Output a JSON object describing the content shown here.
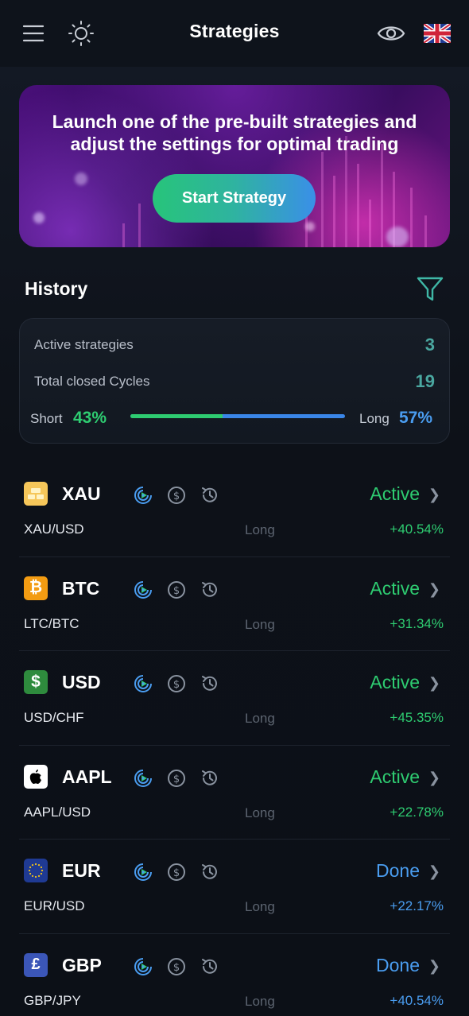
{
  "header": {
    "title": "Strategies",
    "menu_icon": "menu-icon",
    "theme_icon": "sun-icon",
    "visibility_icon": "eye-icon",
    "language_icon": "uk-flag-icon"
  },
  "banner": {
    "headline": "Launch one of the pre-built strategies and adjust the settings for optimal trading",
    "cta_label": "Start Strategy"
  },
  "history": {
    "title": "History",
    "filter_icon": "filter-icon",
    "stats": {
      "active_label": "Active strategies",
      "active_value": "3",
      "closed_label": "Total closed Cycles",
      "closed_value": "19",
      "short_label": "Short",
      "short_value": "43%",
      "long_label": "Long",
      "long_value": "57%",
      "short_fraction": 0.43
    }
  },
  "colors": {
    "active": "#2ecc71",
    "done": "#4a9df0",
    "accent_teal": "#4aa7a0"
  },
  "strategies": [
    {
      "symbol": "XAU",
      "icon": "gold-bars-icon",
      "pair": "XAU/USD",
      "direction": "Long",
      "status": "Active",
      "pnl": "+40.54%"
    },
    {
      "symbol": "BTC",
      "icon": "bitcoin-icon",
      "pair": "LTC/BTC",
      "direction": "Long",
      "status": "Active",
      "pnl": "+31.34%"
    },
    {
      "symbol": "USD",
      "icon": "dollar-icon",
      "pair": "USD/CHF",
      "direction": "Long",
      "status": "Active",
      "pnl": "+45.35%"
    },
    {
      "symbol": "AAPL",
      "icon": "apple-icon",
      "pair": "AAPL/USD",
      "direction": "Long",
      "status": "Active",
      "pnl": "+22.78%"
    },
    {
      "symbol": "EUR",
      "icon": "eu-flag-icon",
      "pair": "EUR/USD",
      "direction": "Long",
      "status": "Done",
      "pnl": "+22.17%"
    },
    {
      "symbol": "GBP",
      "icon": "pound-icon",
      "pair": "GBP/JPY",
      "direction": "Long",
      "status": "Done",
      "pnl": "+40.54%"
    }
  ]
}
